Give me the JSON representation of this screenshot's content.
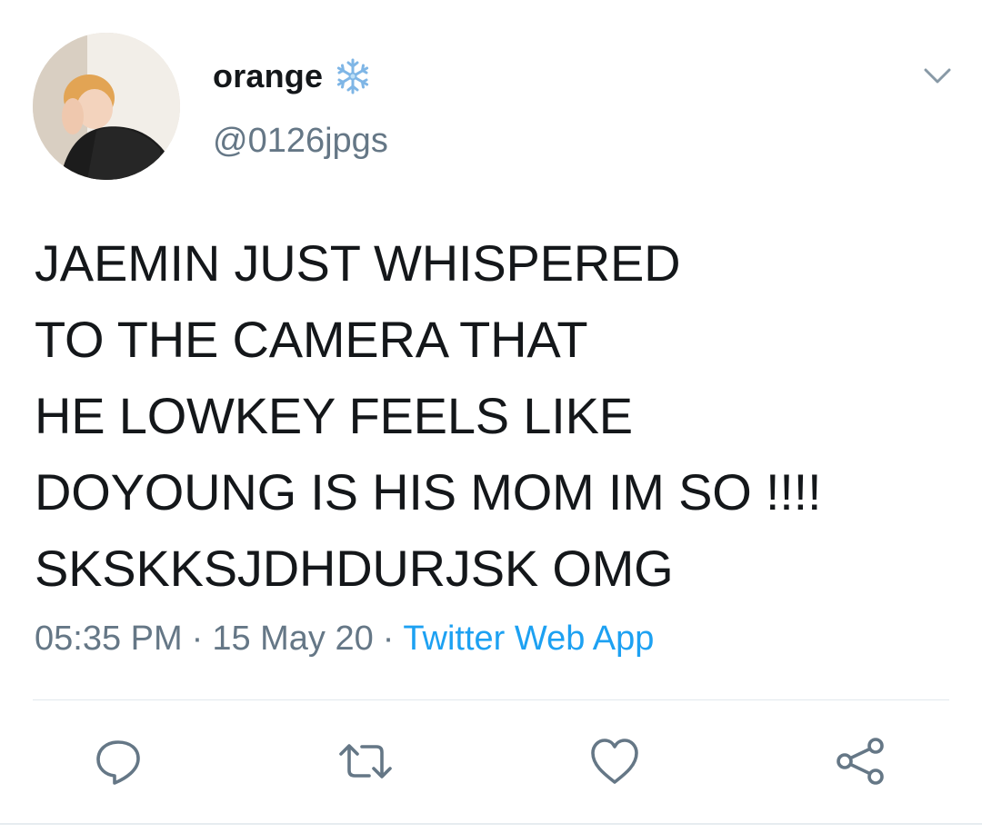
{
  "user": {
    "display_name": "orange",
    "handle": "@0126jpgs",
    "name_emoji": "snowflake-icon"
  },
  "tweet": {
    "text": "JAEMIN JUST WHISPERED\nTO THE CAMERA THAT\nHE LOWKEY FEELS LIKE\nDOYOUNG IS HIS MOM IM SO !!!!\nSKSKKSJDHDURJSK OMG",
    "time": "05:35 PM",
    "separator": "·",
    "date": "15 May 20",
    "source": "Twitter Web App"
  },
  "colors": {
    "text_primary": "#14171a",
    "text_secondary": "#657786",
    "link": "#1da1f2",
    "divider": "#e1e8ed"
  },
  "actions": [
    "reply-icon",
    "retweet-icon",
    "like-icon",
    "share-icon"
  ]
}
